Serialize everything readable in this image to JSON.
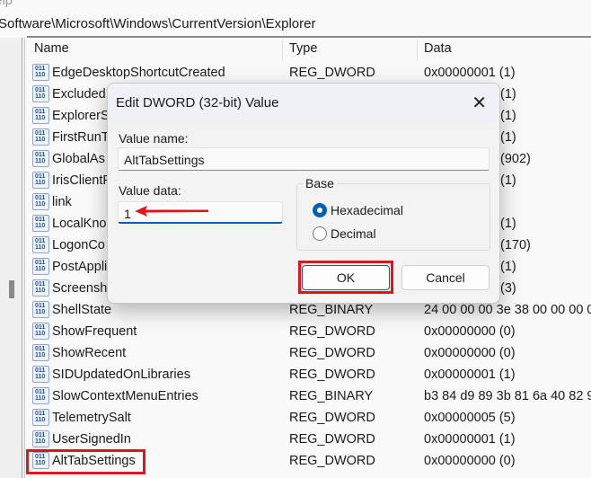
{
  "menu": "elp",
  "path": "Software\\Microsoft\\Windows\\CurrentVersion\\Explorer",
  "columns": {
    "name": "Name",
    "type": "Type",
    "data": "Data"
  },
  "rows": [
    {
      "name": "EdgeDesktopShortcutCreated",
      "type": "REG_DWORD",
      "data": "0x00000001 (1)"
    },
    {
      "name": "Excluded",
      "type": "",
      "data": "(1)"
    },
    {
      "name": "ExplorerS",
      "type": "",
      "data": "(1)"
    },
    {
      "name": "FirstRunTe",
      "type": "",
      "data": "(1)"
    },
    {
      "name": "GlobalAs",
      "type": "",
      "data": "(902)"
    },
    {
      "name": "IrisClientF",
      "type": "",
      "data": "(1)"
    },
    {
      "name": "link",
      "type": "",
      "data": ""
    },
    {
      "name": "LocalKno",
      "type": "",
      "data": "(1)"
    },
    {
      "name": "LogonCo",
      "type": "",
      "data": "(170)"
    },
    {
      "name": "PostAppli",
      "type": "",
      "data": "(1)"
    },
    {
      "name": "Screensho",
      "type": "",
      "data": "(3)"
    },
    {
      "name": "ShellState",
      "type": "REG_BINARY",
      "data": "24 00 00 00 3e 38 00 00 00 0"
    },
    {
      "name": "ShowFrequent",
      "type": "REG_DWORD",
      "data": "0x00000000 (0)"
    },
    {
      "name": "ShowRecent",
      "type": "REG_DWORD",
      "data": "0x00000000 (0)"
    },
    {
      "name": "SIDUpdatedOnLibraries",
      "type": "REG_DWORD",
      "data": "0x00000001 (1)"
    },
    {
      "name": "SlowContextMenuEntries",
      "type": "REG_BINARY",
      "data": "b3 84 d9 89 3b 81 6a 40 82 9"
    },
    {
      "name": "TelemetrySalt",
      "type": "REG_DWORD",
      "data": "0x00000005 (5)"
    },
    {
      "name": "UserSignedIn",
      "type": "REG_DWORD",
      "data": "0x00000001 (1)"
    },
    {
      "name": "AltTabSettings",
      "type": "REG_DWORD",
      "data": "0x00000000 (0)"
    }
  ],
  "icon_glyph": "011 110",
  "dialog": {
    "title": "Edit DWORD (32-bit) Value",
    "value_name_label": "Value name:",
    "value_name": "AltTabSettings",
    "value_data_label": "Value data:",
    "value_data": "1",
    "base_label": "Base",
    "hex_label": "Hexadecimal",
    "dec_label": "Decimal",
    "selected_base": "Hexadecimal",
    "ok": "OK",
    "cancel": "Cancel",
    "close": "✕"
  },
  "colors": {
    "accent": "#005fb8",
    "highlight": "#e3121b"
  }
}
